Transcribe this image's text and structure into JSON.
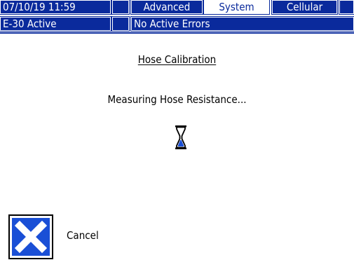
{
  "header": {
    "datetime": "07/10/19 11:59",
    "tabs": [
      {
        "label": "Advanced"
      },
      {
        "label": "System"
      },
      {
        "label": "Cellular"
      }
    ],
    "active_tab": "System"
  },
  "status_bar": {
    "mode": "E-30 Active",
    "errors": "No Active Errors"
  },
  "screen": {
    "title": "Hose Calibration",
    "message": "Measuring Hose Resistance...",
    "progress_icon": "hourglass-icon"
  },
  "actions": {
    "cancel_label": "Cancel",
    "cancel_icon": "close-icon"
  },
  "colors": {
    "accent": "#0a2a9c",
    "cancel_button": "#1a4fd6"
  }
}
